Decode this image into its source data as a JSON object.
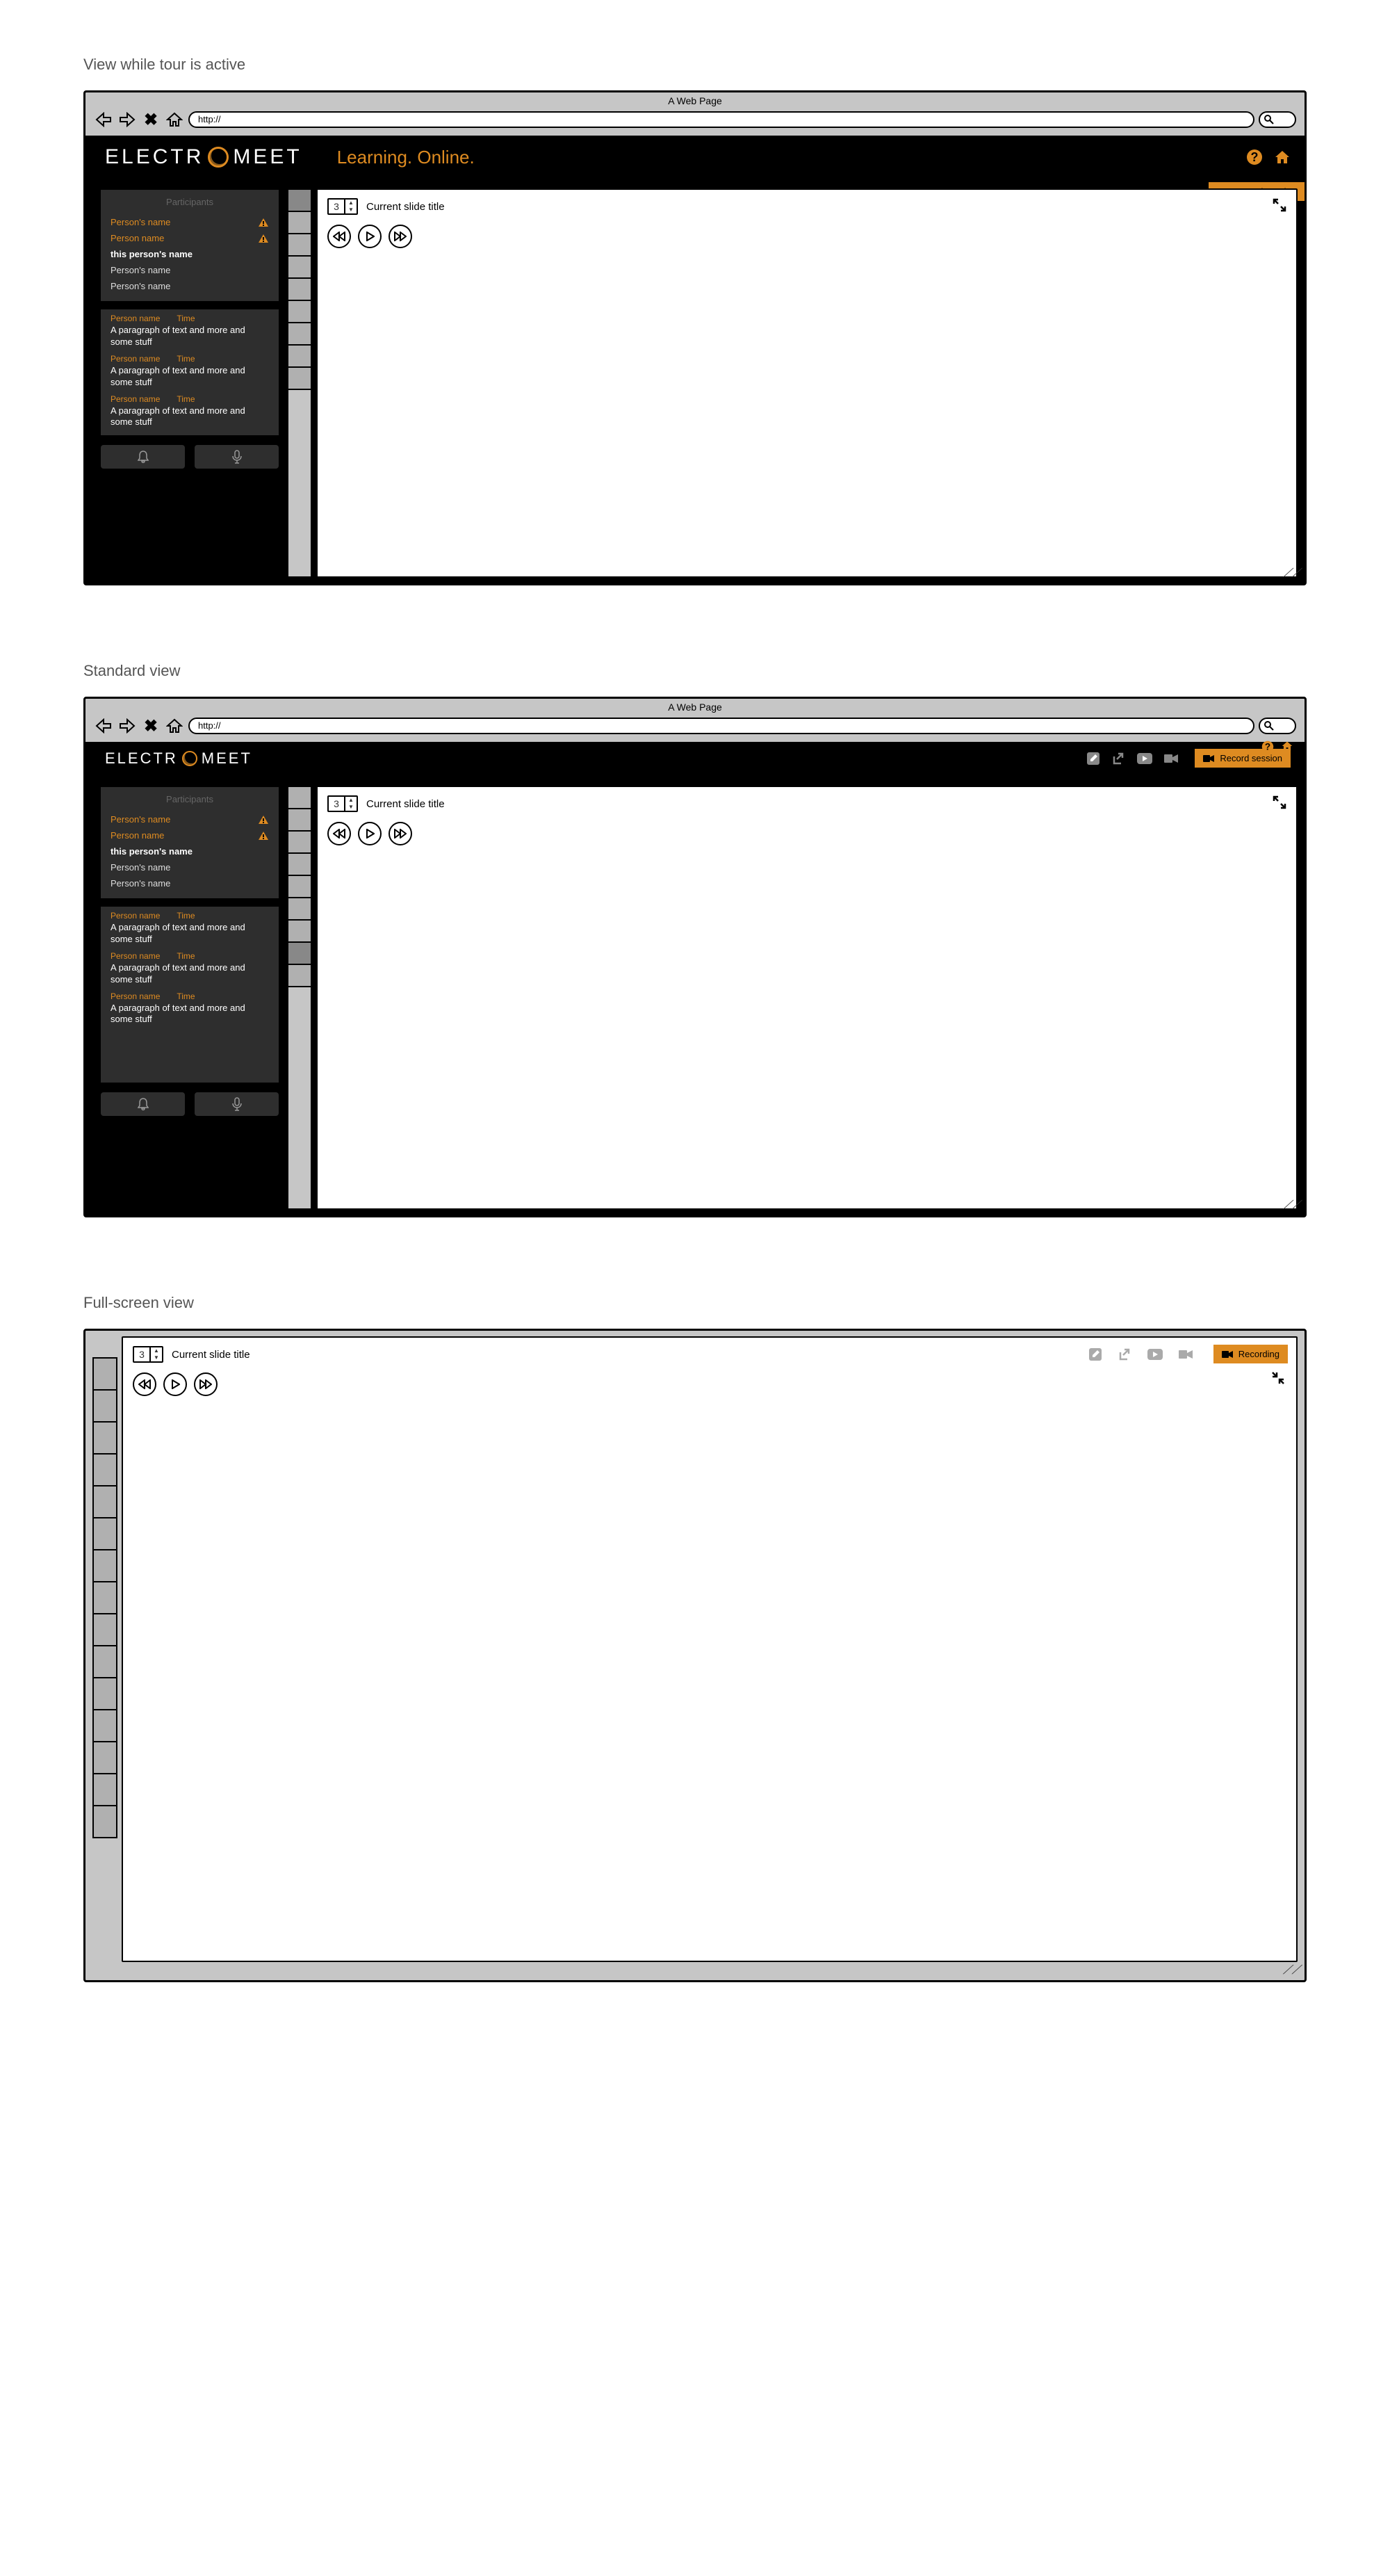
{
  "section_titles": {
    "tour": "View while tour is active",
    "standard": "Standard view",
    "fullscreen": "Full-screen view"
  },
  "browser": {
    "title": "A Web Page",
    "url": "http://"
  },
  "logo": {
    "part1": "ELECTR",
    "part2": "MEET"
  },
  "tagline": "Learning. Online.",
  "record_label": "Record session",
  "recording_label": "Recording",
  "participants_title": "Participants",
  "participants": [
    {
      "name": "Person's name",
      "style": "orange",
      "warn": true
    },
    {
      "name": "Person name",
      "style": "orange",
      "warn": true
    },
    {
      "name": "this person's name",
      "style": "white",
      "warn": false
    },
    {
      "name": "Person's name",
      "style": "gray",
      "warn": false
    },
    {
      "name": "Person's name",
      "style": "gray",
      "warn": false
    }
  ],
  "chat": [
    {
      "name": "Person name",
      "time": "Time",
      "text": "A paragraph of text and more and some stuff"
    },
    {
      "name": "Person name",
      "time": "Time",
      "text": "A paragraph of text and more and some stuff"
    },
    {
      "name": "Person name",
      "time": "Time",
      "text": "A paragraph of text and more and some stuff"
    }
  ],
  "slide": {
    "number": "3",
    "title": "Current slide title"
  }
}
